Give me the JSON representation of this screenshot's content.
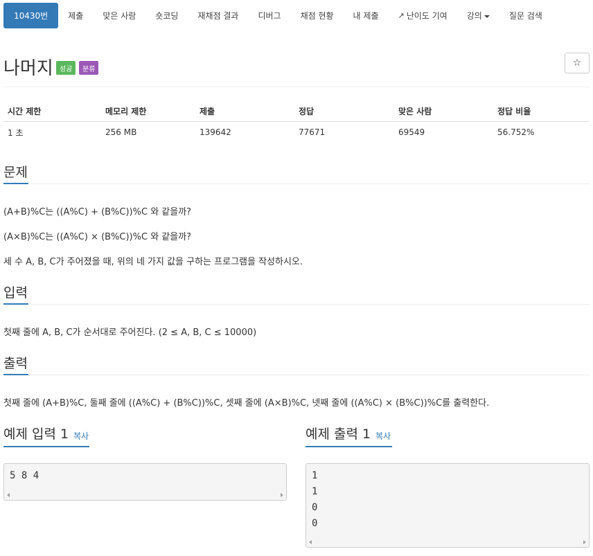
{
  "nav": {
    "tabs": [
      {
        "label": "10430번"
      },
      {
        "label": "제출"
      },
      {
        "label": "맞은 사람"
      },
      {
        "label": "숏코딩"
      },
      {
        "label": "재채점 결과"
      },
      {
        "label": "디버그"
      },
      {
        "label": "채점 현황"
      },
      {
        "label": "내 제출"
      },
      {
        "label": "난이도 기여"
      },
      {
        "label": "강의"
      },
      {
        "label": "질문 검색"
      }
    ]
  },
  "problem": {
    "title": "나머지",
    "badge_success": "성공",
    "badge_category": "분류",
    "star": "☆"
  },
  "info_table": {
    "headers": [
      "시간 제한",
      "메모리 제한",
      "제출",
      "정답",
      "맞은 사람",
      "정답 비율"
    ],
    "values": [
      "1 초",
      "256 MB",
      "139642",
      "77671",
      "69549",
      "56.752%"
    ]
  },
  "sections": {
    "description": {
      "title": "문제",
      "lines": [
        "(A+B)%C는 ((A%C) + (B%C))%C 와 같을까?",
        "(A×B)%C는 ((A%C) × (B%C))%C 와 같을까?",
        "세 수 A, B, C가 주어졌을 때, 위의 네 가지 값을 구하는 프로그램을 작성하시오."
      ]
    },
    "input": {
      "title": "입력",
      "text": "첫째 줄에 A, B, C가 순서대로 주어진다. (2 ≤ A, B, C ≤ 10000)"
    },
    "output": {
      "title": "출력",
      "text": "첫째 줄에 (A+B)%C, 둘째 줄에 ((A%C) + (B%C))%C, 셋째 줄에 (A×B)%C, 넷째 줄에 ((A%C) × (B%C))%C를 출력한다."
    }
  },
  "samples": {
    "input": {
      "title": "예제 입력 1",
      "copy": "복사",
      "lines": [
        "5 8 4"
      ]
    },
    "output": {
      "title": "예제 출력 1",
      "copy": "복사",
      "lines": [
        "1",
        "1",
        "0",
        "0"
      ]
    }
  },
  "colors": {
    "accent": "#337ab7",
    "success": "#5cb85c",
    "category": "#9b59b6"
  }
}
